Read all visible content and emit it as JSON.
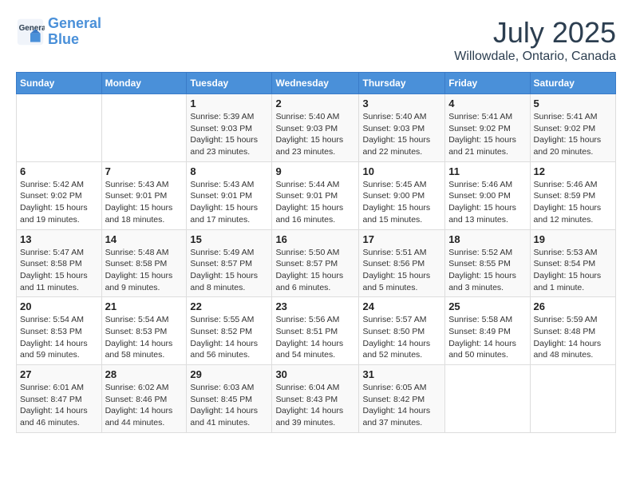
{
  "header": {
    "logo_line1": "General",
    "logo_line2": "Blue",
    "month_title": "July 2025",
    "location": "Willowdale, Ontario, Canada"
  },
  "days_of_week": [
    "Sunday",
    "Monday",
    "Tuesday",
    "Wednesday",
    "Thursday",
    "Friday",
    "Saturday"
  ],
  "weeks": [
    [
      {
        "day": "",
        "info": ""
      },
      {
        "day": "",
        "info": ""
      },
      {
        "day": "1",
        "info": "Sunrise: 5:39 AM\nSunset: 9:03 PM\nDaylight: 15 hours and 23 minutes."
      },
      {
        "day": "2",
        "info": "Sunrise: 5:40 AM\nSunset: 9:03 PM\nDaylight: 15 hours and 23 minutes."
      },
      {
        "day": "3",
        "info": "Sunrise: 5:40 AM\nSunset: 9:03 PM\nDaylight: 15 hours and 22 minutes."
      },
      {
        "day": "4",
        "info": "Sunrise: 5:41 AM\nSunset: 9:02 PM\nDaylight: 15 hours and 21 minutes."
      },
      {
        "day": "5",
        "info": "Sunrise: 5:41 AM\nSunset: 9:02 PM\nDaylight: 15 hours and 20 minutes."
      }
    ],
    [
      {
        "day": "6",
        "info": "Sunrise: 5:42 AM\nSunset: 9:02 PM\nDaylight: 15 hours and 19 minutes."
      },
      {
        "day": "7",
        "info": "Sunrise: 5:43 AM\nSunset: 9:01 PM\nDaylight: 15 hours and 18 minutes."
      },
      {
        "day": "8",
        "info": "Sunrise: 5:43 AM\nSunset: 9:01 PM\nDaylight: 15 hours and 17 minutes."
      },
      {
        "day": "9",
        "info": "Sunrise: 5:44 AM\nSunset: 9:01 PM\nDaylight: 15 hours and 16 minutes."
      },
      {
        "day": "10",
        "info": "Sunrise: 5:45 AM\nSunset: 9:00 PM\nDaylight: 15 hours and 15 minutes."
      },
      {
        "day": "11",
        "info": "Sunrise: 5:46 AM\nSunset: 9:00 PM\nDaylight: 15 hours and 13 minutes."
      },
      {
        "day": "12",
        "info": "Sunrise: 5:46 AM\nSunset: 8:59 PM\nDaylight: 15 hours and 12 minutes."
      }
    ],
    [
      {
        "day": "13",
        "info": "Sunrise: 5:47 AM\nSunset: 8:58 PM\nDaylight: 15 hours and 11 minutes."
      },
      {
        "day": "14",
        "info": "Sunrise: 5:48 AM\nSunset: 8:58 PM\nDaylight: 15 hours and 9 minutes."
      },
      {
        "day": "15",
        "info": "Sunrise: 5:49 AM\nSunset: 8:57 PM\nDaylight: 15 hours and 8 minutes."
      },
      {
        "day": "16",
        "info": "Sunrise: 5:50 AM\nSunset: 8:57 PM\nDaylight: 15 hours and 6 minutes."
      },
      {
        "day": "17",
        "info": "Sunrise: 5:51 AM\nSunset: 8:56 PM\nDaylight: 15 hours and 5 minutes."
      },
      {
        "day": "18",
        "info": "Sunrise: 5:52 AM\nSunset: 8:55 PM\nDaylight: 15 hours and 3 minutes."
      },
      {
        "day": "19",
        "info": "Sunrise: 5:53 AM\nSunset: 8:54 PM\nDaylight: 15 hours and 1 minute."
      }
    ],
    [
      {
        "day": "20",
        "info": "Sunrise: 5:54 AM\nSunset: 8:53 PM\nDaylight: 14 hours and 59 minutes."
      },
      {
        "day": "21",
        "info": "Sunrise: 5:54 AM\nSunset: 8:53 PM\nDaylight: 14 hours and 58 minutes."
      },
      {
        "day": "22",
        "info": "Sunrise: 5:55 AM\nSunset: 8:52 PM\nDaylight: 14 hours and 56 minutes."
      },
      {
        "day": "23",
        "info": "Sunrise: 5:56 AM\nSunset: 8:51 PM\nDaylight: 14 hours and 54 minutes."
      },
      {
        "day": "24",
        "info": "Sunrise: 5:57 AM\nSunset: 8:50 PM\nDaylight: 14 hours and 52 minutes."
      },
      {
        "day": "25",
        "info": "Sunrise: 5:58 AM\nSunset: 8:49 PM\nDaylight: 14 hours and 50 minutes."
      },
      {
        "day": "26",
        "info": "Sunrise: 5:59 AM\nSunset: 8:48 PM\nDaylight: 14 hours and 48 minutes."
      }
    ],
    [
      {
        "day": "27",
        "info": "Sunrise: 6:01 AM\nSunset: 8:47 PM\nDaylight: 14 hours and 46 minutes."
      },
      {
        "day": "28",
        "info": "Sunrise: 6:02 AM\nSunset: 8:46 PM\nDaylight: 14 hours and 44 minutes."
      },
      {
        "day": "29",
        "info": "Sunrise: 6:03 AM\nSunset: 8:45 PM\nDaylight: 14 hours and 41 minutes."
      },
      {
        "day": "30",
        "info": "Sunrise: 6:04 AM\nSunset: 8:43 PM\nDaylight: 14 hours and 39 minutes."
      },
      {
        "day": "31",
        "info": "Sunrise: 6:05 AM\nSunset: 8:42 PM\nDaylight: 14 hours and 37 minutes."
      },
      {
        "day": "",
        "info": ""
      },
      {
        "day": "",
        "info": ""
      }
    ]
  ]
}
